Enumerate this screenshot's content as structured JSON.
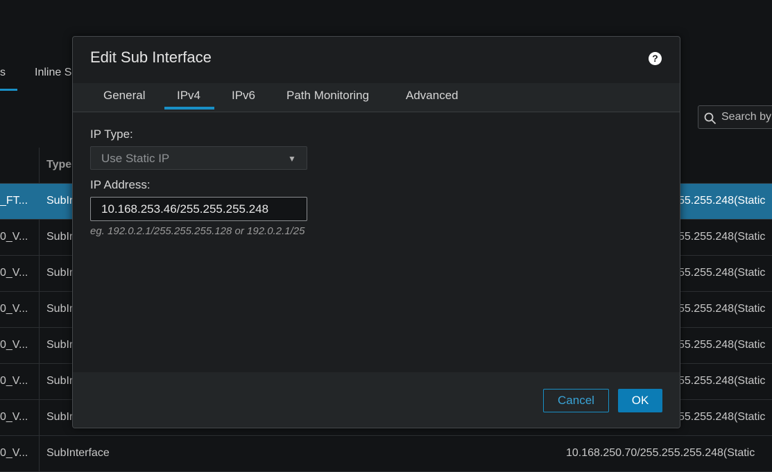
{
  "background": {
    "tabs": [
      {
        "label": "s"
      },
      {
        "label": "Inline S"
      }
    ],
    "search_placeholder": "Search by",
    "table": {
      "header_type": "Type",
      "rows": [
        {
          "name": "_FT...",
          "type": "SubIr",
          "ip": "55.255.248(Static",
          "selected": true
        },
        {
          "name": "0_V...",
          "type": "SubIr",
          "ip": "55.255.248(Static"
        },
        {
          "name": "0_V...",
          "type": "SubIr",
          "ip": "55.255.248(Static"
        },
        {
          "name": "0_V...",
          "type": "SubIr",
          "ip": "55.255.248(Static"
        },
        {
          "name": "0_V...",
          "type": "SubIr",
          "ip": "55.255.248(Static"
        },
        {
          "name": "0_V...",
          "type": "SubIr",
          "ip": "55.255.248(Static"
        },
        {
          "name": "0_V...",
          "type": "SubIr",
          "ip": "55.255.248(Static"
        },
        {
          "name": "0_V...",
          "type": "SubInterface",
          "ip": "10.168.250.70/255.255.255.248(Static"
        }
      ]
    }
  },
  "modal": {
    "title": "Edit Sub Interface",
    "help_glyph": "?",
    "tabs": [
      "General",
      "IPv4",
      "IPv6",
      "Path Monitoring",
      "Advanced"
    ],
    "active_tab": "IPv4",
    "ip_type": {
      "label": "IP Type:",
      "value": "Use Static IP",
      "caret": "▼"
    },
    "ip_address": {
      "label": "IP Address:",
      "value": "10.168.253.46/255.255.255.248"
    },
    "hint": "eg. 192.0.2.1/255.255.255.128 or 192.0.2.1/25",
    "buttons": {
      "cancel": "Cancel",
      "ok": "OK"
    }
  },
  "colors": {
    "accent": "#1990c6",
    "selected_row": "#1f6e96",
    "primary_button": "#0c7cb5"
  }
}
